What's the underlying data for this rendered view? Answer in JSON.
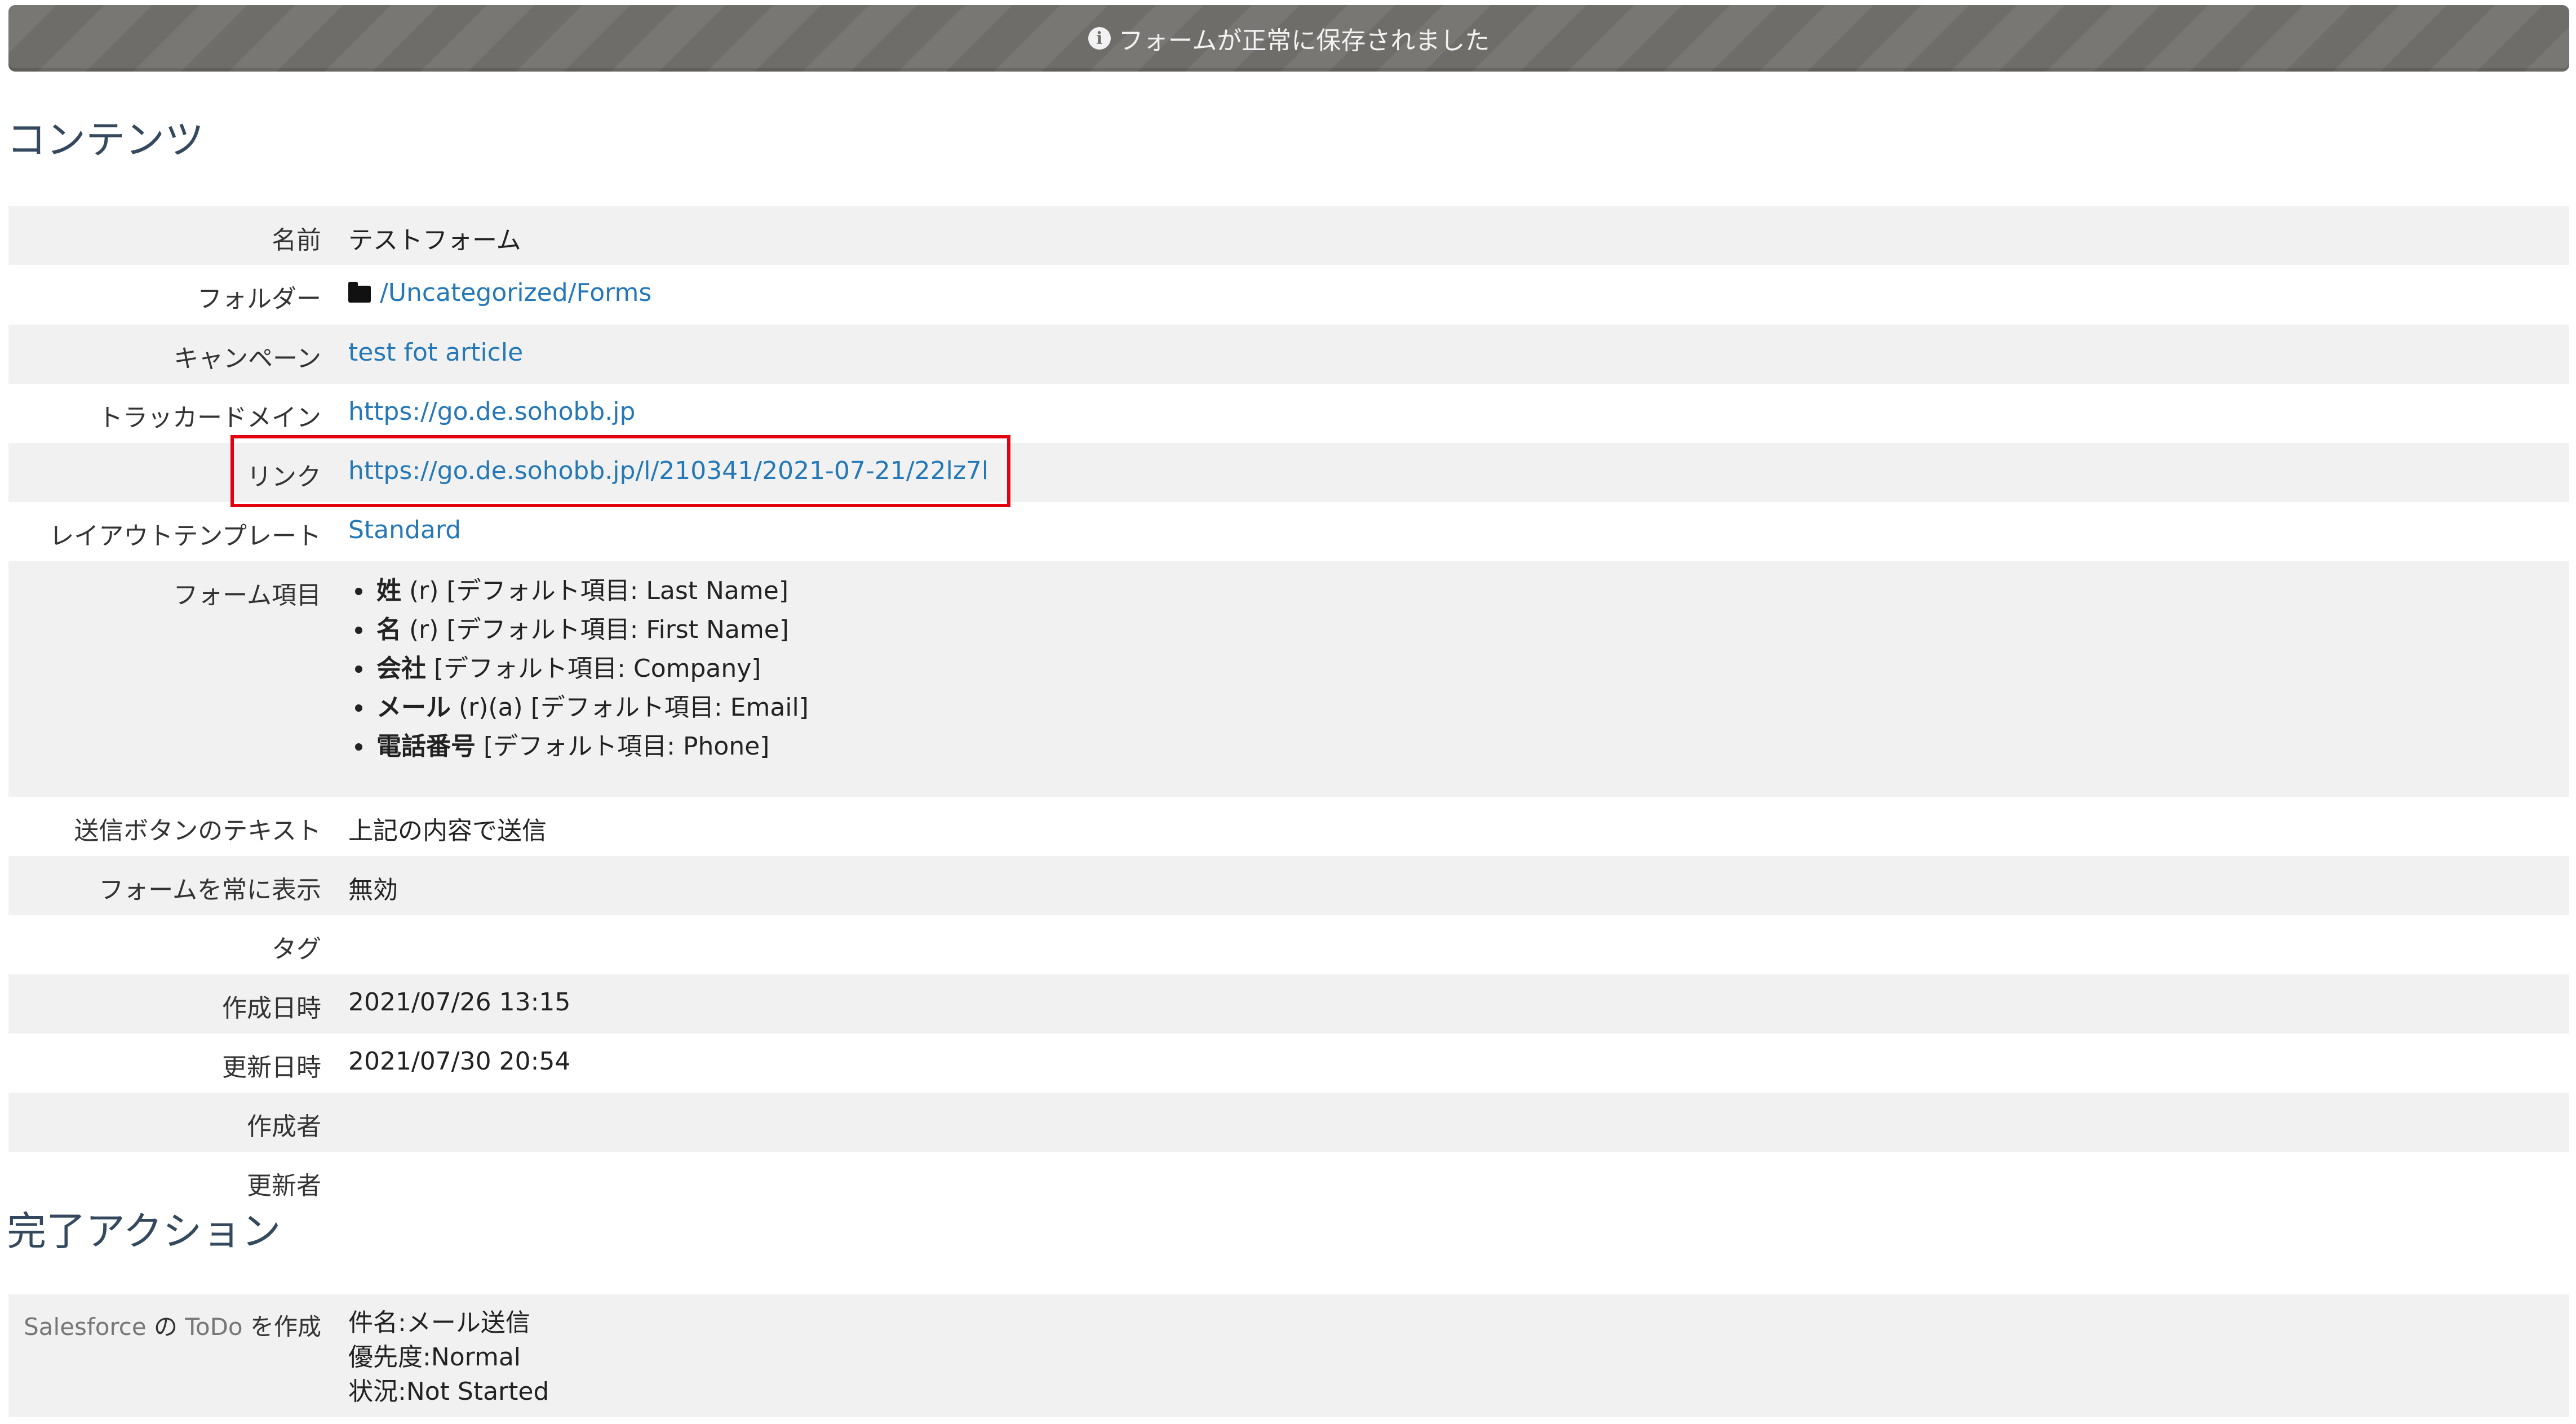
{
  "banner": {
    "message": "フォームが正常に保存されました",
    "icon": "info-circle-icon",
    "color": "#6f6d6a"
  },
  "contents": {
    "title": "コンテンツ",
    "rows": {
      "name": {
        "label": "名前",
        "value": "テストフォーム"
      },
      "folder": {
        "label": "フォルダー",
        "value": "/Uncategorized/Forms",
        "icon": "folder-icon"
      },
      "campaign": {
        "label": "キャンペーン",
        "value": "test fot article"
      },
      "tracker_domain": {
        "label": "トラッカードメイン",
        "value": "https://go.de.sohobb.jp"
      },
      "link": {
        "label": "リンク",
        "value": "https://go.de.sohobb.jp/l/210341/2021-07-21/22lz7l"
      },
      "layout": {
        "label": "レイアウトテンプレート",
        "value": "Standard"
      },
      "fields": {
        "label": "フォーム項目",
        "items": [
          {
            "name": "姓",
            "detail": "(r) [デフォルト項目: Last Name]"
          },
          {
            "name": "名",
            "detail": "(r) [デフォルト項目: First Name]"
          },
          {
            "name": "会社",
            "detail": "[デフォルト項目: Company]"
          },
          {
            "name": "メール",
            "detail": "(r)(a) [デフォルト項目: Email]"
          },
          {
            "name": "電話番号",
            "detail": "[デフォルト項目: Phone]"
          }
        ]
      },
      "submit_text": {
        "label": "送信ボタンのテキスト",
        "value": "上記の内容で送信"
      },
      "always_show": {
        "label": "フォームを常に表示",
        "value": "無効"
      },
      "tags": {
        "label": "タグ",
        "value": ""
      },
      "created_at": {
        "label": "作成日時",
        "value": "2021/07/26 13:15"
      },
      "updated_at": {
        "label": "更新日時",
        "value": "2021/07/30 20:54"
      },
      "created_by": {
        "label": "作成者",
        "value": ""
      },
      "updated_by": {
        "label": "更新者",
        "value": ""
      }
    }
  },
  "completion": {
    "title": "完了アクション",
    "action": {
      "label_part1": "Salesforce",
      "label_part2": " の ",
      "label_part3": "ToDo",
      "label_part4": " を作成",
      "lines": [
        "件名:メール送信",
        "優先度:Normal",
        "状況:Not Started"
      ]
    }
  },
  "colors": {
    "link": "#2478b8",
    "highlight": "#e3000f",
    "row_alt": "#f1f1f1",
    "title": "#34495e"
  }
}
